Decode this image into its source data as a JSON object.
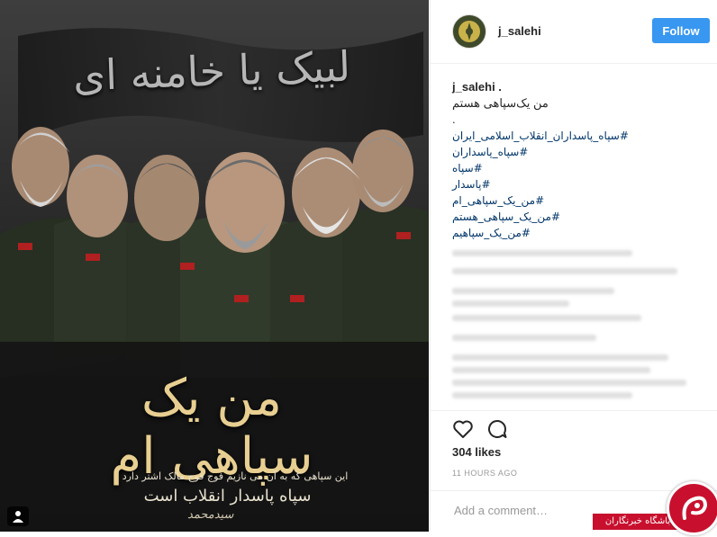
{
  "post": {
    "poster": {
      "banner_text": "لبیک یا خامنه ای",
      "headline": "من یک سپاهی ام",
      "line1": "این سپاهی که به آن می نازیم    فوج فوج مالک اشتر دارد",
      "line2": "سپاه پاسدار انقلاب است",
      "signature": "سیدمحمد",
      "tag_icon": "person-tag-icon"
    },
    "colors": {
      "accent": "#3897f0",
      "hashtag": "#003569",
      "headline": "#e8cf91",
      "watermark": "#c8102e"
    }
  },
  "header": {
    "username": "j_salehi",
    "follow_label": "Follow",
    "avatar_icon": "irgc-emblem-icon"
  },
  "caption": {
    "username": "j_salehi .",
    "text": "من یک‌سپاهی هستم",
    "dot": ".",
    "hashtags": [
      "#سپاه_پاسداران_انقلاب_اسلامی_ایران",
      "#سپاه_پاسداران",
      "#سپاه",
      "#پاسدار",
      "#من_یک_سپاهی_ام",
      "#من_یک_سپاهی_هستم",
      "#من_یک_سپاهیم"
    ]
  },
  "actions": {
    "like_icon": "heart-icon",
    "comment_icon": "comment-icon"
  },
  "likes": "304 likes",
  "time": "11 HOURS AGO",
  "comment": {
    "placeholder": "Add a comment…"
  },
  "watermark": {
    "text": "باشگاه خبرنگاران"
  }
}
